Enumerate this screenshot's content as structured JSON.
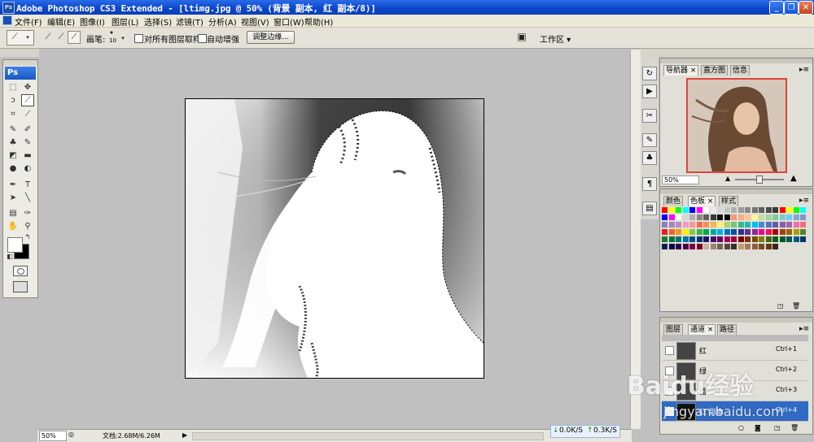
{
  "window": {
    "title": "Adobe Photoshop CS3 Extended - [ltimg.jpg @ 50% (背景 副本, 红 副本/8)]",
    "app_icon": "Ps",
    "minimize": "_",
    "restore": "❐",
    "close": "✕"
  },
  "menus": [
    "文件(F)",
    "编辑(E)",
    "图像(I)",
    "图层(L)",
    "选择(S)",
    "滤镜(T)",
    "分析(A)",
    "视图(V)",
    "窗口(W)",
    "帮助(H)"
  ],
  "options": {
    "brush_label": "画笔:",
    "brush_size": "10",
    "sample_all_layers": "对所有图层取样",
    "auto_enhance": "自动增强",
    "refine_edge": "调整边缘...",
    "workspace": "工作区 ▾"
  },
  "toolbox": {
    "ps_label": "Ps"
  },
  "panels": {
    "nav_tabs": [
      "导航器 ×",
      "直方图",
      "信息"
    ],
    "zoom": "50%",
    "color_tabs": [
      "颜色",
      "色板 ×",
      "样式"
    ],
    "channel_tabs": [
      "图层",
      "通道 ×",
      "路径"
    ],
    "channels": [
      {
        "name": "红",
        "shortcut": "Ctrl+1"
      },
      {
        "name": "绿",
        "shortcut": "Ctrl+2"
      },
      {
        "name": "蓝",
        "shortcut": "Ctrl+3"
      },
      {
        "name": "红 副本",
        "shortcut": "Ctrl+4"
      }
    ]
  },
  "status": {
    "zoom": "50%",
    "doc": "文档:2.68M/6.26M",
    "down_speed": "0.0K/S",
    "up_speed": "0.3K/S"
  },
  "watermark": {
    "brand": "Baidu经验",
    "url": "jingyan.baidu.com"
  },
  "colors": {
    "title_blue": "#0a45c9",
    "selected_channel": "#316ac5"
  }
}
